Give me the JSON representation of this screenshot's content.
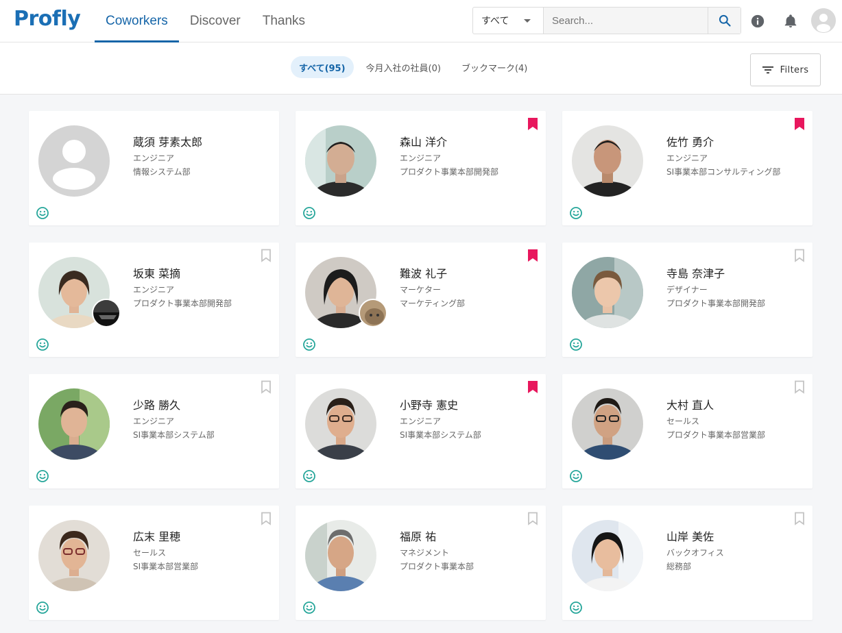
{
  "header": {
    "logo": "Profly",
    "nav": [
      {
        "label": "Coworkers",
        "active": true
      },
      {
        "label": "Discover",
        "active": false
      },
      {
        "label": "Thanks",
        "active": false
      }
    ],
    "search": {
      "scope": "すべて",
      "placeholder": "Search..."
    },
    "icons": [
      "info-icon",
      "bell-icon",
      "search-icon",
      "user-avatar"
    ]
  },
  "subbar": {
    "tabs": [
      {
        "label": "すべて(95)",
        "active": true
      },
      {
        "label": "今月入社の社員(0)",
        "active": false
      },
      {
        "label": "ブックマーク(4)",
        "active": false
      }
    ],
    "filters_label": "Filters"
  },
  "colors": {
    "accent": "#1565a8",
    "bookmark": "#e8175d",
    "smile": "#26a69a"
  },
  "people": [
    {
      "name": "蔵須 芽素太郎",
      "role": "エンジニア",
      "dept": "情報システム部",
      "bookmark": "none"
    },
    {
      "name": "森山 洋介",
      "role": "エンジニア",
      "dept": "プロダクト事業本部開発部",
      "bookmark": "filled"
    },
    {
      "name": "佐竹 勇介",
      "role": "エンジニア",
      "dept": "SI事業本部コンサルティング部",
      "bookmark": "filled"
    },
    {
      "name": "坂東 菜摘",
      "role": "エンジニア",
      "dept": "プロダクト事業本部開発部",
      "bookmark": "outline"
    },
    {
      "name": "難波 礼子",
      "role": "マーケター",
      "dept": "マーケティング部",
      "bookmark": "filled"
    },
    {
      "name": "寺島 奈津子",
      "role": "デザイナー",
      "dept": "プロダクト事業本部開発部",
      "bookmark": "outline"
    },
    {
      "name": "少路 勝久",
      "role": "エンジニア",
      "dept": "SI事業本部システム部",
      "bookmark": "outline"
    },
    {
      "name": "小野寺 憲史",
      "role": "エンジニア",
      "dept": "SI事業本部システム部",
      "bookmark": "filled"
    },
    {
      "name": "大村 直人",
      "role": "セールス",
      "dept": "プロダクト事業本部営業部",
      "bookmark": "outline"
    },
    {
      "name": "広末 里穂",
      "role": "セールス",
      "dept": "SI事業本部営業部",
      "bookmark": "outline"
    },
    {
      "name": "福原 祐",
      "role": "マネジメント",
      "dept": "プロダクト事業本部",
      "bookmark": "outline"
    },
    {
      "name": "山岸 美佐",
      "role": "バックオフィス",
      "dept": "総務部",
      "bookmark": "outline"
    }
  ]
}
